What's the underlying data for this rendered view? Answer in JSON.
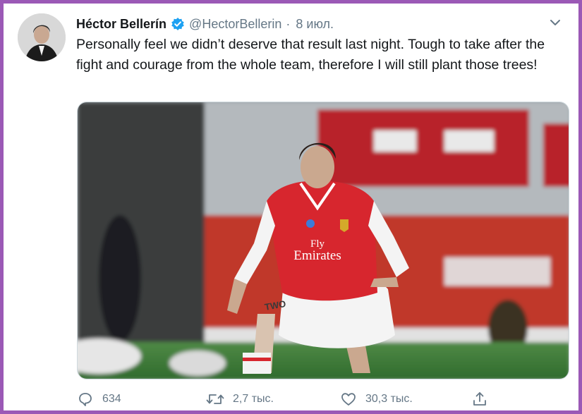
{
  "tweet": {
    "author_name": "Héctor Bellerín",
    "handle": "@HectorBellerin",
    "separator": "·",
    "date": "8 июл.",
    "text": "Personally feel we didn’t deserve that result last night. Tough to take after the fight and courage from the whole team, therefore I will still plant those trees!",
    "verified": true
  },
  "media": {
    "shirt_sponsor_line1": "Fly",
    "shirt_sponsor_line2": "Emirates",
    "leg_tattoo": "TWO",
    "colors": {
      "shirt_red": "#d7262e",
      "stadium_red": "#c0392b",
      "pitch_green": "#3e7a3a"
    }
  },
  "actions": {
    "reply_count": "634",
    "retweet_count": "2,7 тыс.",
    "like_count": "30,3 тыс.",
    "icons": [
      "reply-icon",
      "retweet-icon",
      "like-icon",
      "share-icon"
    ]
  },
  "theme": {
    "frame_border": "#9b59b6",
    "verified_blue": "#1da1f2",
    "muted_text": "#657786"
  }
}
